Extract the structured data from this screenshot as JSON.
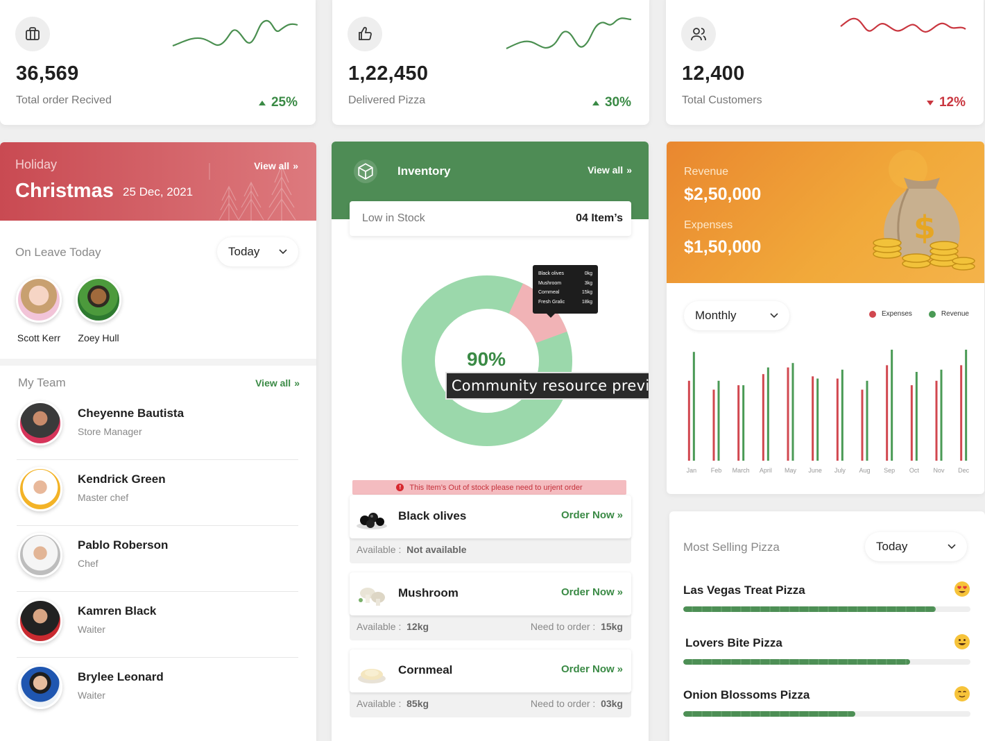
{
  "stats": [
    {
      "value": "36,569",
      "label": "Total order Recived",
      "pct": "25%",
      "trend": "up",
      "icon": "briefcase-icon",
      "color": "#3a8a45"
    },
    {
      "value": "1,22,450",
      "label": "Delivered Pizza",
      "pct": "30%",
      "trend": "up",
      "icon": "thumbs-up-icon",
      "color": "#3a8a45"
    },
    {
      "value": "12,400",
      "label": "Total Customers",
      "pct": "12%",
      "trend": "down",
      "icon": "users-icon",
      "color": "#c9363f"
    }
  ],
  "holiday": {
    "sub": "Holiday",
    "title": "Christmas",
    "date": "25 Dec, 2021",
    "view_all": "View all"
  },
  "leave": {
    "label": "On Leave Today",
    "select": "Today",
    "people": [
      "Scott Kerr",
      "Zoey Hull"
    ]
  },
  "team": {
    "label": "My Team",
    "view_all": "View all",
    "members": [
      {
        "name": "Cheyenne Bautista",
        "role": "Store Manager"
      },
      {
        "name": "Kendrick Green",
        "role": "Master chef"
      },
      {
        "name": "Pablo Roberson",
        "role": "Chef"
      },
      {
        "name": "Kamren Black",
        "role": "Waiter"
      },
      {
        "name": "Brylee Leonard",
        "role": "Waiter"
      }
    ]
  },
  "inventory": {
    "title": "Inventory",
    "view_all": "View all",
    "low_label": "Low in Stock",
    "low_value": "04 Item’s",
    "donut_pct": "90%",
    "donut_value": 90,
    "tooltip": [
      {
        "name": "Black olives",
        "qty": "0kg"
      },
      {
        "name": "Mushroom",
        "qty": "3kg"
      },
      {
        "name": "Cornmeal",
        "qty": "15kg"
      },
      {
        "name": "Fresh Gralic",
        "qty": "18kg"
      }
    ],
    "preview": "Community resource preview",
    "oos": "This Item’s Out of stock please need to urjent order",
    "items": [
      {
        "name": "Black olives",
        "order": "Order Now",
        "avail_label": "Available",
        "avail": "Not available",
        "need_label": "",
        "need": ""
      },
      {
        "name": "Mushroom",
        "order": "Order Now",
        "avail_label": "Available",
        "avail": "12kg",
        "need_label": "Need to order",
        "need": "15kg"
      },
      {
        "name": "Cornmeal",
        "order": "Order Now",
        "avail_label": "Available",
        "avail": "85kg",
        "need_label": "Need to order",
        "need": "03kg"
      }
    ]
  },
  "revenue": {
    "rev_label": "Revenue",
    "rev_value": "$2,50,000",
    "exp_label": "Expenses",
    "exp_value": "$1,50,000",
    "select": "Monthly",
    "legend_expenses": "Expenses",
    "legend_revenue": "Revenue",
    "color_expenses": "#d1474f",
    "color_revenue": "#4a9a55"
  },
  "chart_data": {
    "type": "bar",
    "categories": [
      "Jan",
      "Feb",
      "March",
      "April",
      "May",
      "June",
      "July",
      "Aug",
      "Sep",
      "Oct",
      "Nov",
      "Dec"
    ],
    "series": [
      {
        "name": "Expenses",
        "values": [
          72,
          64,
          68,
          78,
          84,
          76,
          74,
          64,
          86,
          68,
          72,
          86
        ]
      },
      {
        "name": "Revenue",
        "values": [
          98,
          72,
          68,
          84,
          88,
          74,
          82,
          72,
          100,
          80,
          82,
          100
        ]
      }
    ],
    "ylim": [
      0,
      100
    ]
  },
  "most_selling": {
    "label": "Most Selling Pizza",
    "select": "Today",
    "pizzas": [
      {
        "name": "Las Vegas Treat Pizza",
        "value": 88,
        "emoji": "heart-eyes-emoji-icon"
      },
      {
        "name": "Lovers Bite Pizza",
        "value": 79,
        "emoji": "smile-emoji-icon"
      },
      {
        "name": "Onion Blossoms Pizza",
        "value": 60,
        "emoji": "slight-smile-emoji-icon"
      }
    ]
  }
}
